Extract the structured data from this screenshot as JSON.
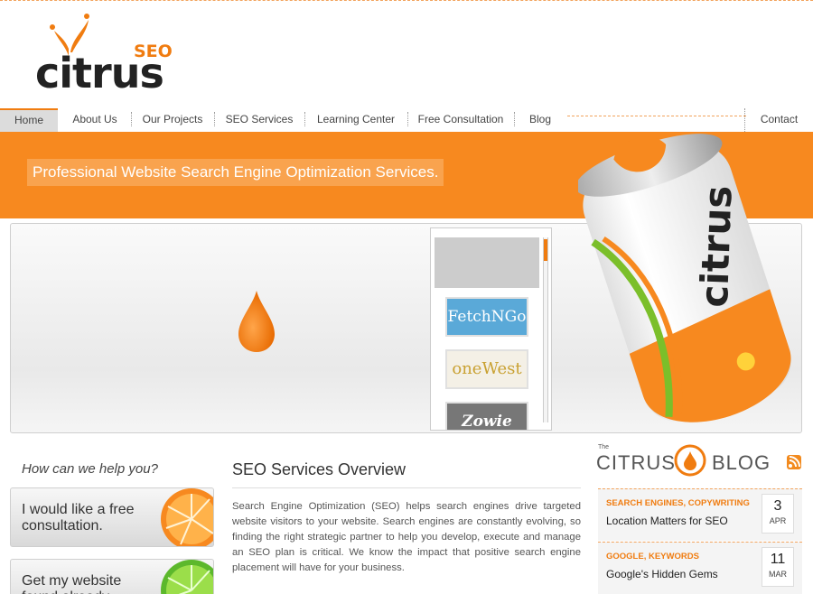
{
  "logo": {
    "word": "citrus",
    "badge": "SEO"
  },
  "nav": {
    "items": [
      {
        "label": "Home"
      },
      {
        "label": "About Us"
      },
      {
        "label": "Our Projects"
      },
      {
        "label": "SEO Services"
      },
      {
        "label": "Learning Center"
      },
      {
        "label": "Free Consultation"
      },
      {
        "label": "Blog"
      }
    ],
    "contact": "Contact"
  },
  "banner": {
    "tagline": "Professional Website Search Engine Optimization Services."
  },
  "portfolio": {
    "thumbs": [
      {
        "label": "FetchNGo"
      },
      {
        "label": "oneWest"
      },
      {
        "label": "Zowie"
      }
    ]
  },
  "help": {
    "title": "How can we help you?",
    "cta1": "I would like a free consultation.",
    "cta2": "Get my website found already."
  },
  "overview": {
    "title": "SEO Services Overview",
    "text": "Search Engine Optimization (SEO) helps search engines drive targeted website visitors to your website. Search engines are constantly evolving, so finding the right strategic partner to help you develop, execute and manage an SEO plan is critical. We know the impact that positive search engine placement will have for your business."
  },
  "blog": {
    "the": "The",
    "citrus": "CITRUS",
    "blog": "BLOG",
    "posts": [
      {
        "category": "SEARCH ENGINES, COPYWRITING",
        "title": "Location Matters for SEO",
        "day": "3",
        "month": "APR"
      },
      {
        "category": "GOOGLE, KEYWORDS",
        "title": "Google's Hidden Gems",
        "day": "11",
        "month": "MAR"
      }
    ]
  },
  "colors": {
    "accent": "#f7891f",
    "text": "#333333"
  }
}
